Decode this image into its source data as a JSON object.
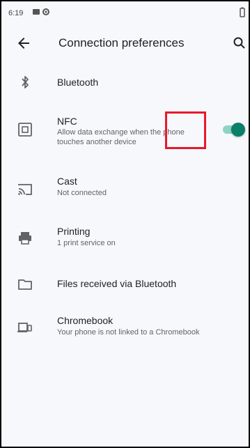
{
  "status_bar": {
    "time": "6:19",
    "icons": [
      "message-icon",
      "gear-icon",
      "battery-icon"
    ]
  },
  "app_bar": {
    "title": "Connection preferences",
    "back_icon": "arrow-left-icon",
    "search_icon": "search-icon"
  },
  "items": [
    {
      "icon": "bluetooth-icon",
      "title": "Bluetooth",
      "subtitle": ""
    },
    {
      "icon": "nfc-icon",
      "title": "NFC",
      "subtitle": "Allow data exchange when the phone touches another device",
      "toggle": true
    },
    {
      "icon": "cast-icon",
      "title": "Cast",
      "subtitle": "Not connected"
    },
    {
      "icon": "printer-icon",
      "title": "Printing",
      "subtitle": "1 print service on"
    },
    {
      "icon": "folder-icon",
      "title": "Files received via Bluetooth",
      "subtitle": ""
    },
    {
      "icon": "chromebook-icon",
      "title": "Chromebook",
      "subtitle": "Your phone is not linked to a Chromebook"
    }
  ],
  "colors": {
    "accent": "#0a7f6a",
    "accent_track": "#8fd3c4",
    "highlight": "#e8182c",
    "background": "#f7f8fb"
  }
}
